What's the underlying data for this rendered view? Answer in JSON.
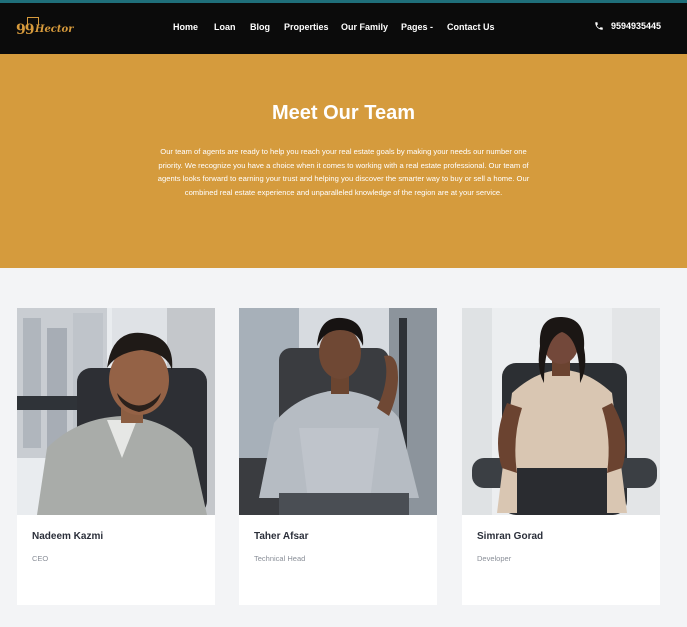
{
  "header": {
    "logo": {
      "number": "99",
      "name": "Hector"
    },
    "nav": [
      {
        "label": "Home"
      },
      {
        "label": "Loan"
      },
      {
        "label": "Blog"
      },
      {
        "label": "Properties"
      },
      {
        "label": "Our Family"
      },
      {
        "label": "Pages -"
      },
      {
        "label": "Contact Us"
      }
    ],
    "phone": {
      "icon": "phone-icon",
      "number": "9594935445"
    }
  },
  "hero": {
    "title": "Meet Our Team",
    "description": "Our team of agents are ready to help you reach your real estate goals by making your needs our number one priority. We recognize you have a choice when it comes to working with a real estate professional. Our team of agents looks forward to earning your trust and helping you discover the smarter way to buy or sell a home. Our combined real estate experience and unparalleled knowledge of the region are at your service."
  },
  "team": [
    {
      "name": "Nadeem Kazmi",
      "role": "CEO"
    },
    {
      "name": "Taher Afsar",
      "role": "Technical Head"
    },
    {
      "name": "Simran Gorad",
      "role": "Developer"
    }
  ],
  "colors": {
    "accent": "#d59b3d",
    "navbar": "#0b0b0b",
    "background": "#f3f4f6"
  }
}
